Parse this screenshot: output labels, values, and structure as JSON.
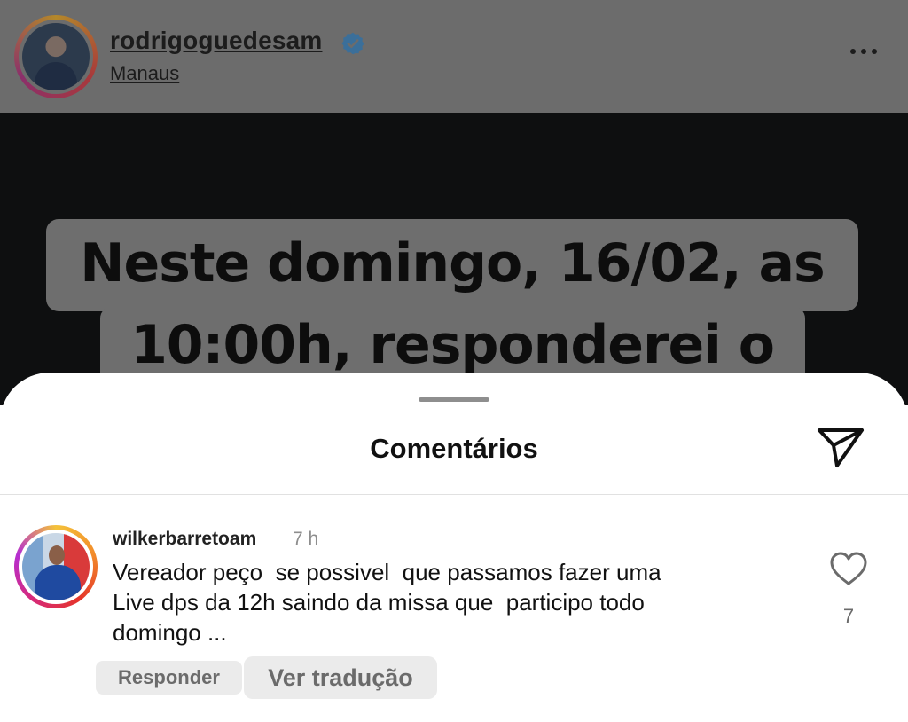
{
  "header": {
    "username": "rodrigoguedesam",
    "location": "Manaus",
    "verified_icon": "verified-badge-icon",
    "more_icon": "more-horizontal-icon"
  },
  "post": {
    "line1": "Neste domingo, 16/02, as",
    "line2": "10:00h, responderei o"
  },
  "comments_sheet": {
    "title": "Comentários",
    "share_icon": "send-icon",
    "comments": [
      {
        "username": "wilkerbarretoam",
        "time": "7 h",
        "text": "Vereador peço  se possivel  que passamos fazer uma\nLive dps da 12h saindo da missa que  participo todo\ndomingo ...",
        "likes": "7",
        "reply_label": "Responder",
        "translate_label": "Ver tradução"
      }
    ]
  },
  "colors": {
    "header_dim": "#6c6c6c",
    "post_bg": "#0e0f10",
    "verified_blue": "#3b6f9a"
  }
}
